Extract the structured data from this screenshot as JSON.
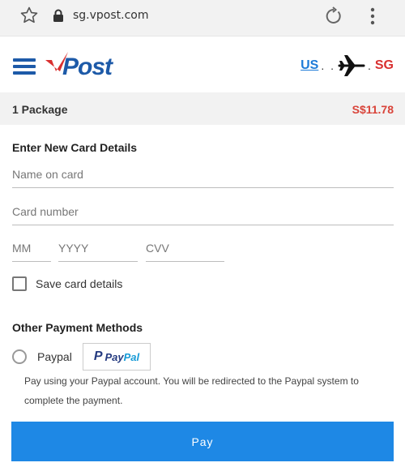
{
  "browser": {
    "url": "sg.vpost.com"
  },
  "header": {
    "logo_text": "vPost",
    "route_from": "US",
    "route_dots": ". .",
    "route_dots_after": ".",
    "route_to": "SG"
  },
  "summary": {
    "package_label": "1 Package",
    "price": "S$11.78"
  },
  "card_form": {
    "title": "Enter New Card Details",
    "name_placeholder": "Name on card",
    "number_placeholder": "Card number",
    "month_placeholder": "MM",
    "year_placeholder": "YYYY",
    "cvv_placeholder": "CVV",
    "save_label": "Save card details",
    "save_checked": false
  },
  "other_methods": {
    "title": "Other Payment Methods",
    "paypal_label": "Paypal",
    "paypal_badge_pay": "Pay",
    "paypal_badge_pal": "Pal",
    "description": "Pay using your Paypal account. You will be redirected to the Paypal system to complete the payment.",
    "selected": false
  },
  "pay_button": {
    "label": "Pay",
    "color": "#1e88e5"
  },
  "colors": {
    "brand_blue": "#1d5aa8",
    "price_red": "#d9443a",
    "paypal_dark": "#253b80",
    "paypal_light": "#179bd7"
  },
  "icons": [
    "star-icon",
    "lock-icon",
    "reload-icon",
    "kebab-menu-icon",
    "hamburger-menu-icon",
    "plane-icon",
    "paypal-p-icon"
  ]
}
